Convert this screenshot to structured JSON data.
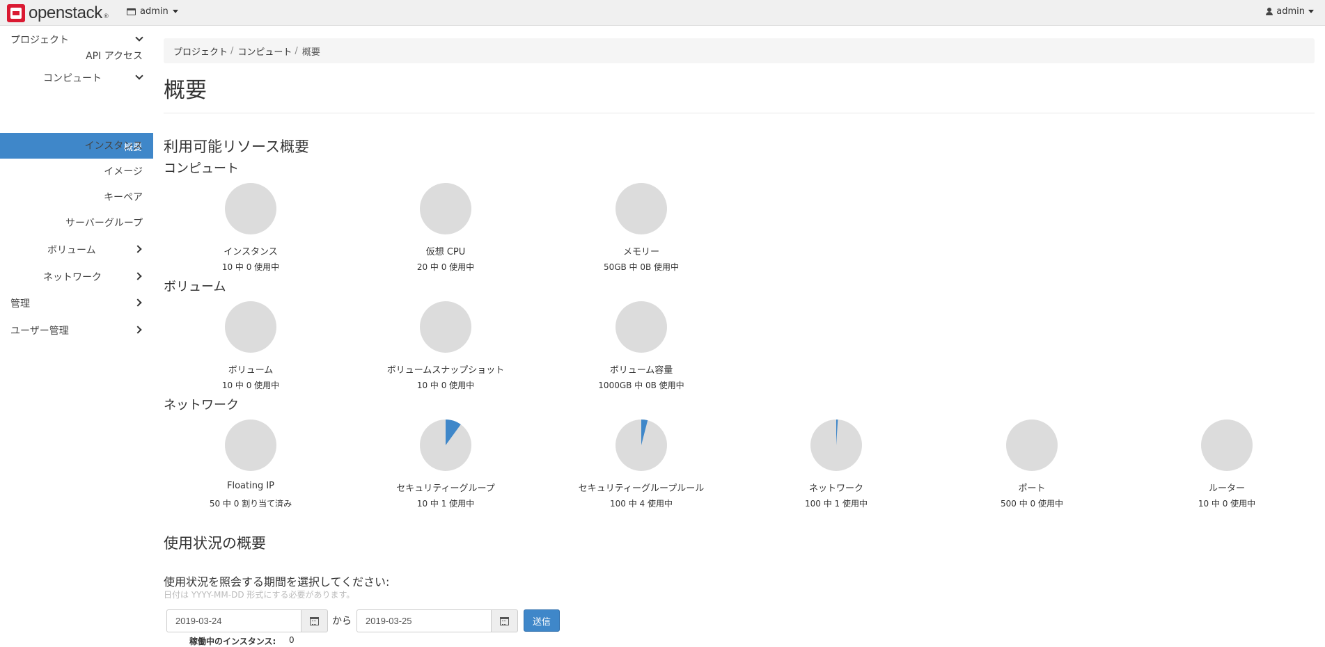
{
  "topbar": {
    "logo_text": "openstack",
    "logo_mark": "®",
    "project_label": "admin",
    "user_label": "admin"
  },
  "sidebar": {
    "project": "プロジェクト",
    "api_access": "API アクセス",
    "compute": "コンピュート",
    "overview": "概要",
    "instances": "インスタンス",
    "images": "イメージ",
    "keypairs": "キーペア",
    "server_groups": "サーバーグループ",
    "volumes": "ボリューム",
    "network": "ネットワーク",
    "admin": "管理",
    "identity": "ユーザー管理"
  },
  "breadcrumb": {
    "items": [
      "プロジェクト",
      "コンピュート"
    ],
    "separator": "/",
    "current": "概要"
  },
  "page_title": "概要",
  "limits": {
    "heading": "利用可能リソース概要",
    "compute": {
      "heading": "コンピュート",
      "pies": [
        {
          "label": "インスタンス",
          "usage": "10 中 0 使用中",
          "fraction": 0
        },
        {
          "label": "仮想 CPU",
          "usage": "20 中 0 使用中",
          "fraction": 0
        },
        {
          "label": "メモリー",
          "usage": "50GB 中 0B 使用中",
          "fraction": 0
        }
      ]
    },
    "volume": {
      "heading": "ボリューム",
      "pies": [
        {
          "label": "ボリューム",
          "usage": "10 中 0 使用中",
          "fraction": 0
        },
        {
          "label": "ボリュームスナップショット",
          "usage": "10 中 0 使用中",
          "fraction": 0
        },
        {
          "label": "ボリューム容量",
          "usage": "1000GB 中 0B 使用中",
          "fraction": 0
        }
      ]
    },
    "network": {
      "heading": "ネットワーク",
      "pies": [
        {
          "label": "Floating IP",
          "usage": "50 中 0 割り当て済み",
          "fraction": 0
        },
        {
          "label": "セキュリティーグループ",
          "usage": "10 中 1 使用中",
          "fraction": 0.1
        },
        {
          "label": "セキュリティーグループルール",
          "usage": "100 中 4 使用中",
          "fraction": 0.04
        },
        {
          "label": "ネットワーク",
          "usage": "100 中 1 使用中",
          "fraction": 0.01
        },
        {
          "label": "ポート",
          "usage": "500 中 0 使用中",
          "fraction": 0
        },
        {
          "label": "ルーター",
          "usage": "10 中 0 使用中",
          "fraction": 0
        }
      ]
    },
    "colors": {
      "empty": "#dcdcdc",
      "used": "#3f87c9"
    }
  },
  "usage": {
    "heading": "使用状況の概要",
    "prompt": "使用状況を照会する期間を選択してください:",
    "hint": "日付は YYYY-MM-DD 形式にする必要があります。",
    "start_date": "2019-03-24",
    "end_date": "2019-03-25",
    "range_word": "から",
    "submit_label": "送信",
    "active_instances_label": "稼働中のインスタンス:",
    "active_instances_value": "0"
  }
}
